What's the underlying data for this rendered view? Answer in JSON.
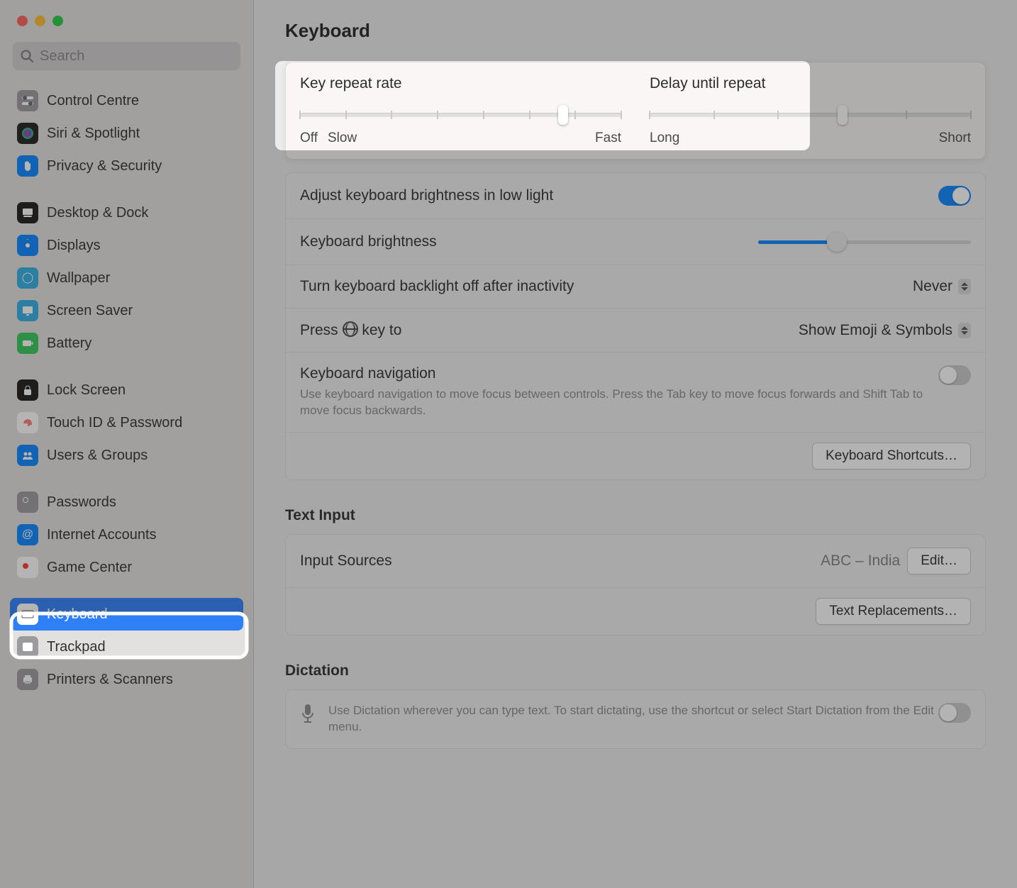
{
  "header": {
    "title": "Keyboard"
  },
  "search": {
    "placeholder": "Search"
  },
  "sidebar": {
    "items": [
      {
        "label": "Control Centre",
        "icon": "control-centre-icon",
        "bg": "#9b9b9e"
      },
      {
        "label": "Siri & Spotlight",
        "icon": "siri-icon",
        "bg": "#1f1f1f"
      },
      {
        "label": "Privacy & Security",
        "icon": "hand-icon",
        "bg": "#0a84ff"
      },
      {
        "label": "Desktop & Dock",
        "icon": "dock-icon",
        "bg": "#1a1a1a"
      },
      {
        "label": "Displays",
        "icon": "displays-icon",
        "bg": "#0a84ff"
      },
      {
        "label": "Wallpaper",
        "icon": "wallpaper-icon",
        "bg": "#32ade6"
      },
      {
        "label": "Screen Saver",
        "icon": "screensaver-icon",
        "bg": "#32ade6"
      },
      {
        "label": "Battery",
        "icon": "battery-icon",
        "bg": "#34c759"
      },
      {
        "label": "Lock Screen",
        "icon": "lock-icon",
        "bg": "#1a1a1a"
      },
      {
        "label": "Touch ID & Password",
        "icon": "fingerprint-icon",
        "bg": "#ffffff"
      },
      {
        "label": "Users & Groups",
        "icon": "users-icon",
        "bg": "#0a84ff"
      },
      {
        "label": "Passwords",
        "icon": "key-icon",
        "bg": "#9b9b9e"
      },
      {
        "label": "Internet Accounts",
        "icon": "at-icon",
        "bg": "#0a84ff"
      },
      {
        "label": "Game Center",
        "icon": "gamecenter-icon",
        "bg": "#ffffff"
      },
      {
        "label": "Keyboard",
        "icon": "keyboard-icon",
        "bg": "#ffffff",
        "selected": true
      },
      {
        "label": "Trackpad",
        "icon": "trackpad-icon",
        "bg": "#9b9b9e"
      },
      {
        "label": "Printers & Scanners",
        "icon": "printer-icon",
        "bg": "#9b9b9e"
      }
    ]
  },
  "sliders": {
    "key_repeat": {
      "title": "Key repeat rate",
      "off": "Off",
      "left": "Slow",
      "right": "Fast",
      "ticks": 8,
      "pos_pct": 82
    },
    "delay": {
      "title": "Delay until repeat",
      "left": "Long",
      "right": "Short",
      "ticks": 6,
      "pos_pct": 60
    }
  },
  "rows": {
    "auto_brightness": {
      "label": "Adjust keyboard brightness in low light",
      "on": true
    },
    "brightness": {
      "label": "Keyboard brightness",
      "value_pct": 37
    },
    "backlight_off": {
      "label": "Turn keyboard backlight off after inactivity",
      "value": "Never"
    },
    "globe_key": {
      "label_prefix": "Press",
      "label_suffix": "key to",
      "value": "Show Emoji & Symbols"
    },
    "navigation": {
      "label": "Keyboard navigation",
      "sub": "Use keyboard navigation to move focus between controls. Press the Tab key to move focus forwards and Shift Tab to move focus backwards.",
      "on": false
    },
    "shortcuts_btn": "Keyboard Shortcuts…"
  },
  "text_input": {
    "title": "Text Input",
    "input_sources_label": "Input Sources",
    "input_sources_value": "ABC – India",
    "edit_btn": "Edit…",
    "replacements_btn": "Text Replacements…"
  },
  "dictation": {
    "title": "Dictation",
    "sub": "Use Dictation wherever you can type text. To start dictating, use the shortcut or select Start Dictation from the Edit menu.",
    "on": false
  }
}
